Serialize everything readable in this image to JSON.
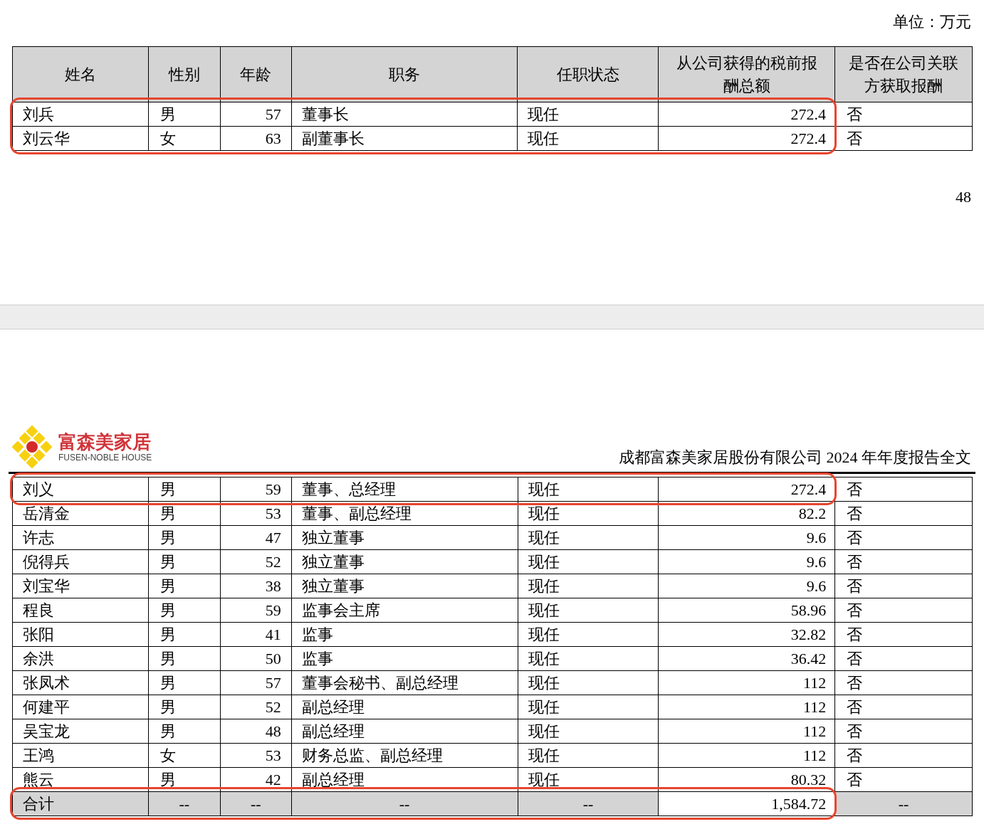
{
  "page1": {
    "unit": "单位：万元",
    "table": {
      "columns": [
        "姓名",
        "性别",
        "年龄",
        "职务",
        "任职状态",
        "从公司获得的税前报酬总额",
        "是否在公司关联方获取报酬"
      ],
      "rows": [
        {
          "cells": [
            "刘兵",
            "男",
            "57",
            "董事长",
            "现任",
            "272.4",
            "否"
          ],
          "highlighted": true
        },
        {
          "cells": [
            "刘云华",
            "女",
            "63",
            "副董事长",
            "现任",
            "272.4",
            "否"
          ],
          "highlighted": true
        }
      ]
    },
    "page_number": "48"
  },
  "page2": {
    "logo": {
      "name": "富森美家居",
      "tagline": "FUSEN-NOBLE HOUSE"
    },
    "header_title": "成都富森美家居股份有限公司 2024 年年度报告全文",
    "table": {
      "rows": [
        {
          "cells": [
            "刘义",
            "男",
            "59",
            "董事、总经理",
            "现任",
            "272.4",
            "否"
          ],
          "highlighted": true
        },
        {
          "cells": [
            "岳清金",
            "男",
            "53",
            "董事、副总经理",
            "现任",
            "82.2",
            "否"
          ],
          "highlighted": false
        },
        {
          "cells": [
            "许志",
            "男",
            "47",
            "独立董事",
            "现任",
            "9.6",
            "否"
          ],
          "highlighted": false
        },
        {
          "cells": [
            "倪得兵",
            "男",
            "52",
            "独立董事",
            "现任",
            "9.6",
            "否"
          ],
          "highlighted": false
        },
        {
          "cells": [
            "刘宝华",
            "男",
            "38",
            "独立董事",
            "现任",
            "9.6",
            "否"
          ],
          "highlighted": false
        },
        {
          "cells": [
            "程良",
            "男",
            "59",
            "监事会主席",
            "现任",
            "58.96",
            "否"
          ],
          "highlighted": false
        },
        {
          "cells": [
            "张阳",
            "男",
            "41",
            "监事",
            "现任",
            "32.82",
            "否"
          ],
          "highlighted": false
        },
        {
          "cells": [
            "余洪",
            "男",
            "50",
            "监事",
            "现任",
            "36.42",
            "否"
          ],
          "highlighted": false
        },
        {
          "cells": [
            "张凤术",
            "男",
            "57",
            "董事会秘书、副总经理",
            "现任",
            "112",
            "否"
          ],
          "highlighted": false
        },
        {
          "cells": [
            "何建平",
            "男",
            "52",
            "副总经理",
            "现任",
            "112",
            "否"
          ],
          "highlighted": false
        },
        {
          "cells": [
            "吴宝龙",
            "男",
            "48",
            "副总经理",
            "现任",
            "112",
            "否"
          ],
          "highlighted": false
        },
        {
          "cells": [
            "王鸿",
            "女",
            "53",
            "财务总监、副总经理",
            "现任",
            "112",
            "否"
          ],
          "highlighted": false
        },
        {
          "cells": [
            "熊云",
            "男",
            "42",
            "副总经理",
            "现任",
            "80.32",
            "否"
          ],
          "highlighted": false
        },
        {
          "cells": [
            "合计",
            "--",
            "--",
            "--",
            "--",
            "1,584.72",
            "--"
          ],
          "highlighted": true,
          "kind": "total"
        }
      ]
    }
  }
}
